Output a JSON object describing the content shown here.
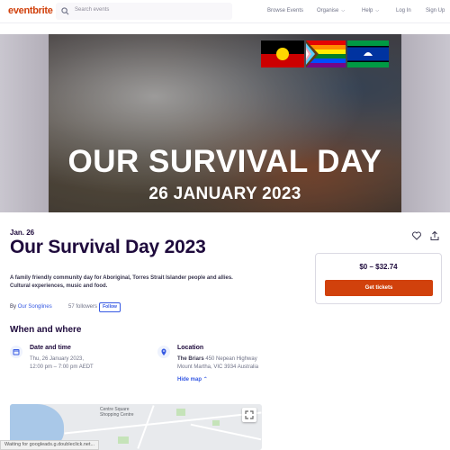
{
  "header": {
    "logo": "eventbrite",
    "search_placeholder": "Search events",
    "nav": {
      "browse": "Browse Events",
      "organise": "Organise",
      "help": "Help",
      "login": "Log In",
      "signup": "Sign Up"
    }
  },
  "hero": {
    "title": "OUR SURVIVAL DAY",
    "date": "26 JANUARY 2023"
  },
  "event": {
    "date_short": "Jan. 26",
    "title": "Our Survival Day 2023",
    "summary": "A family friendly community day for Aboriginal, Torres Strait Islander people and allies. Cultural experiences, music and food.",
    "by_label": "By",
    "organizer": "Our Songlines",
    "followers": "57 followers",
    "follow_label": "Follow"
  },
  "when_where": {
    "section_title": "When and where",
    "date_heading": "Date and time",
    "date_line1": "Thu, 26 January 2023,",
    "date_line2": "12:00 pm – 7:00 pm AEDT",
    "location_heading": "Location",
    "venue": "The Briars",
    "address1": "450 Nepean Highway",
    "address2": "Mount Martha, VIC 3934 Australia",
    "hide_map": "Hide map"
  },
  "ticket": {
    "price": "$0 – $32.74",
    "button": "Get tickets"
  },
  "map": {
    "label": "Centre Square\nShopping Centre"
  },
  "status_bar": "Waiting for googleads.g.doubleclick.net...",
  "colors": {
    "brand": "#d1410c",
    "link": "#3659e3",
    "heading": "#1e0a3c"
  }
}
